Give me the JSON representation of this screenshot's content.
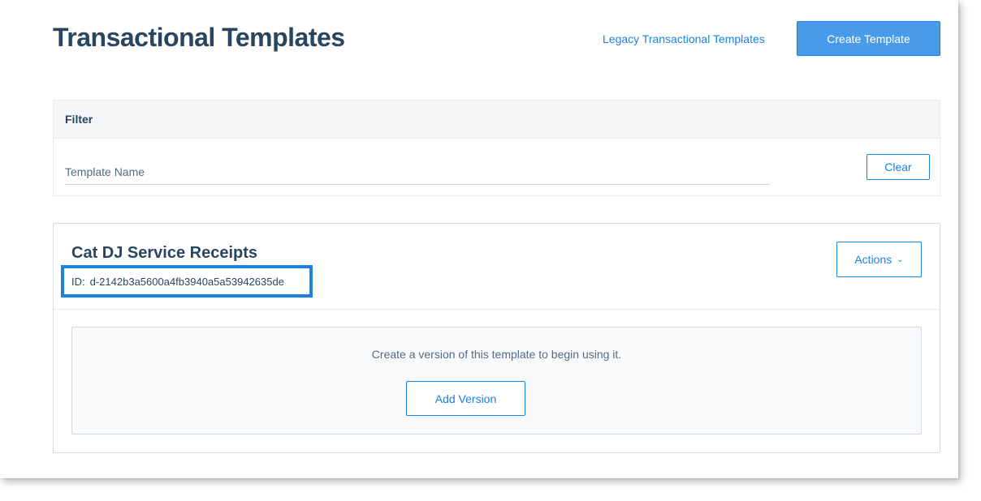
{
  "header": {
    "title": "Transactional Templates",
    "legacy_link": "Legacy Transactional Templates",
    "create_button": "Create Template"
  },
  "filter": {
    "heading": "Filter",
    "template_name_placeholder": "Template Name",
    "clear_button": "Clear"
  },
  "template": {
    "name": "Cat DJ Service Receipts",
    "id_label": "ID:",
    "id_value": "d-2142b3a5600a4fb3940a5a53942635de",
    "actions_button": "Actions",
    "empty_message": "Create a version of this template to begin using it.",
    "add_version_button": "Add Version"
  },
  "colors": {
    "accent": "#1a82e2",
    "primary_button": "#489be8",
    "heading_text": "#294661",
    "highlight_box": "#1a82e2"
  },
  "icons": {
    "actions_dropdown": "chevron-down-icon"
  }
}
